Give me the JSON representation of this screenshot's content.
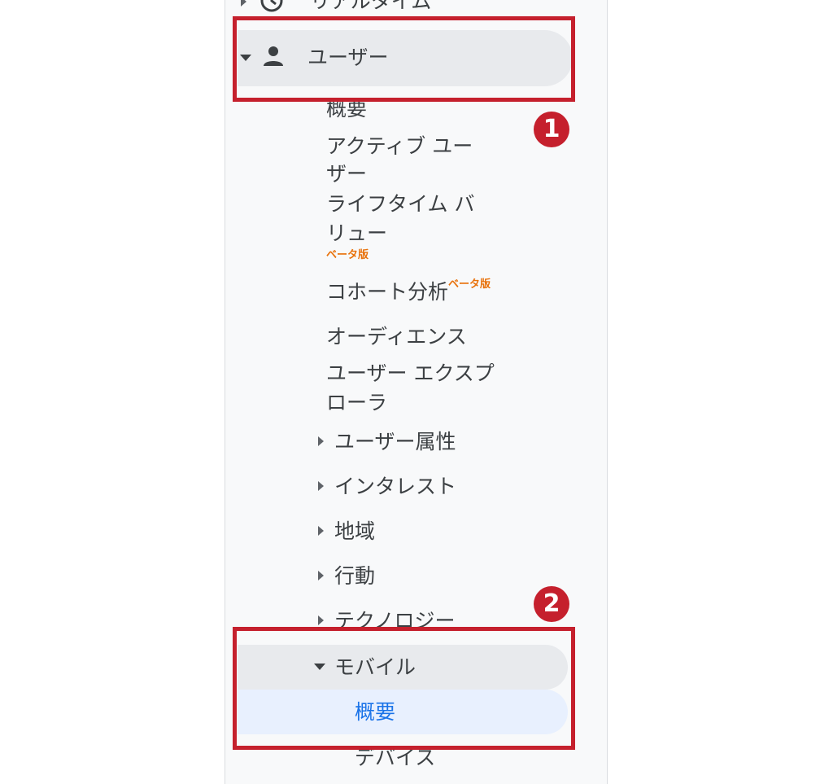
{
  "sidebar": {
    "realtime": {
      "label": "リアルタイム",
      "icon": "clock-icon"
    },
    "user": {
      "label": "ユーザー",
      "icon": "person-icon"
    },
    "user_items": {
      "overview": "概要",
      "active_users_1": "アクティブ ユー",
      "active_users_2": "ザー",
      "ltv_1": "ライフタイム バ",
      "ltv_2": "リュー",
      "ltv_beta": "ベータ版",
      "cohort": "コホート分析",
      "cohort_beta": "ベータ版",
      "audience": "オーディエンス",
      "explorer_1": "ユーザー エクスプ",
      "explorer_2": "ローラ",
      "demographics": "ユーザー属性",
      "interests": "インタレスト",
      "geo": "地域",
      "behavior": "行動",
      "technology": "テクノロジー"
    },
    "mobile": {
      "label": "モバイル",
      "overview": "概要",
      "devices": "デバイス"
    }
  },
  "annotations": {
    "badge1": "1",
    "badge2": "2"
  },
  "colors": {
    "highlight_box": "#c5202d",
    "beta": "#e8710a",
    "active_text": "#1a73e8",
    "active_bg": "#e8f0fe",
    "selected_bg": "#e8eaed"
  }
}
